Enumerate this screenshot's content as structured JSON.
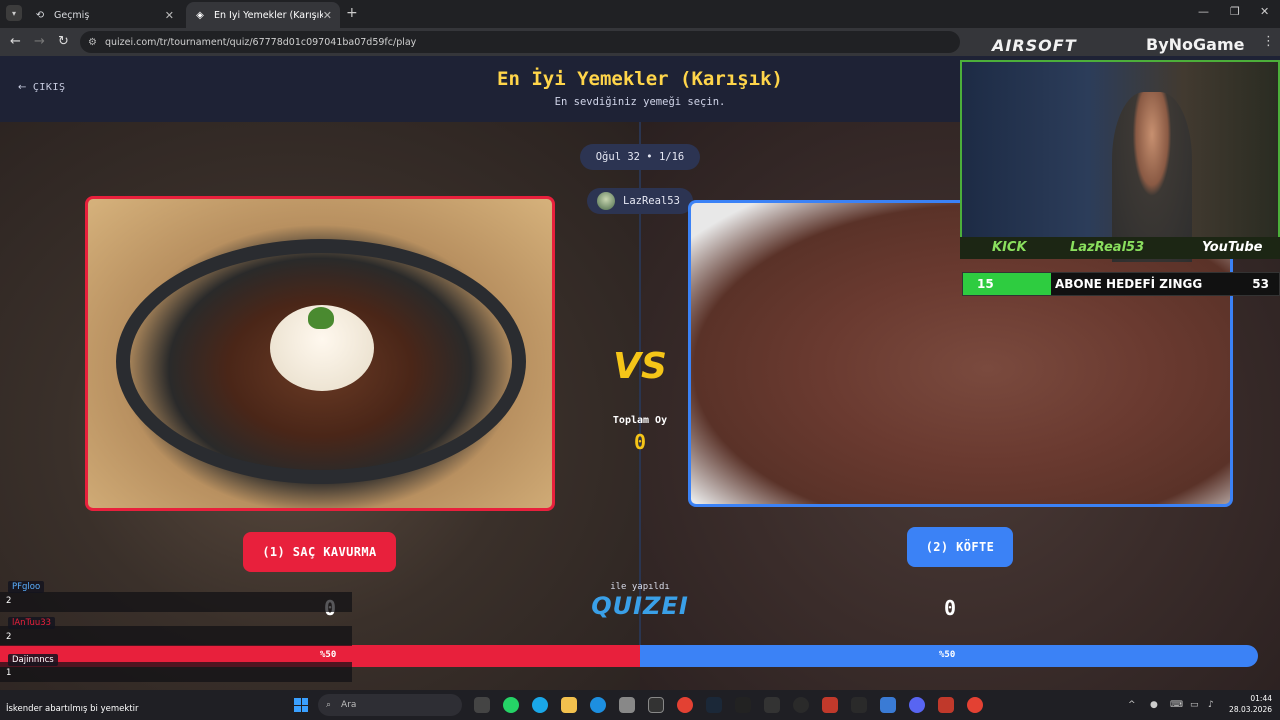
{
  "browser": {
    "tabs": [
      {
        "label": "Geçmiş",
        "icon": "history-icon"
      },
      {
        "label": "En İyi Yemekler (Karışık) - Tier L",
        "icon": "quizei-favicon-icon"
      }
    ],
    "url": "quizei.com/tr/tournament/quiz/67778d01c097041ba07d59fc/play"
  },
  "header": {
    "back_label": "ÇIKIŞ",
    "title": "En İyi Yemekler (Karışık)",
    "subtitle": "En sevdiğiniz yemeği seçin."
  },
  "round": {
    "label": "Oğul 32 • 1/16"
  },
  "user": {
    "name": "LazReal53"
  },
  "left_choice": {
    "label": "(1) SAÇ KAVURMA",
    "votes": "0",
    "percent": "%50"
  },
  "right_choice": {
    "label": "(2) KÖFTE",
    "votes": "0",
    "percent": "%50"
  },
  "vs": {
    "text": "VS",
    "total_label": "Toplam Oy",
    "total_value": "0"
  },
  "footer": {
    "made_with": "ile yapıldı",
    "brand": "QUIZEI"
  },
  "vote_split": {
    "left_fraction": 0.5,
    "right_fraction": 0.5
  },
  "chat": [
    {
      "name": "PFgloo",
      "count": "2"
    },
    {
      "name": "lAnTuu33",
      "count": "2"
    },
    {
      "name": "Dajinnncs",
      "count": "1"
    },
    {
      "name": "lAnTuu33",
      "count": ""
    }
  ],
  "chat_message": "İskender abartılmış bi yemektir",
  "stream": {
    "logo_left": "AIRSOFT",
    "logo_right": "ByNoGame",
    "cam_bar": [
      "KICK",
      "LazReal53",
      "YouTube"
    ],
    "goal_current": "15",
    "goal_label": "ABONE HEDEFİ ZINGG",
    "goal_target": "53",
    "goal_fraction": 0.28
  },
  "taskbar": {
    "search_placeholder": "Ara",
    "time": "01:44",
    "date": "28.03.2026"
  },
  "colors": {
    "red": "#e8203c",
    "blue": "#3b82f6",
    "gold": "#ffd54a"
  }
}
